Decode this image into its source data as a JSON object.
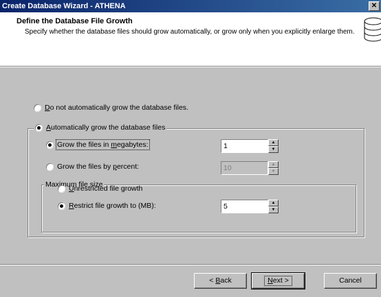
{
  "window": {
    "title": "Create Database Wizard - ATHENA",
    "close_glyph": "✕"
  },
  "header": {
    "title": "Define the Database File Growth",
    "description": "Specify whether the database files should grow automatically, or grow only when you explicitly enlarge them.",
    "icon": "database-cylinder-icon"
  },
  "options": {
    "no_grow": {
      "label_prefix": "",
      "mnemonic": "D",
      "label_rest": "o not automatically grow the database files.",
      "selected": false
    },
    "auto_grow": {
      "label_prefix": "",
      "mnemonic": "A",
      "label_rest": "utomatically grow the database files",
      "selected": true
    }
  },
  "growth": {
    "megabytes": {
      "label_prefix": "Grow the files in ",
      "mnemonic": "m",
      "label_rest": "egabytes:",
      "selected": true,
      "value": "1"
    },
    "percent": {
      "label_prefix": "Grow the files by ",
      "mnemonic": "p",
      "label_rest": "ercent:",
      "selected": false,
      "value": "10"
    }
  },
  "max_size": {
    "legend": "Maximum file size",
    "unrestricted": {
      "label_prefix": "",
      "mnemonic": "U",
      "label_rest": "nrestricted file growth",
      "selected": false
    },
    "restrict": {
      "label_prefix": "",
      "mnemonic": "R",
      "label_rest": "estrict file growth to (MB):",
      "selected": true,
      "value": "5"
    }
  },
  "buttons": {
    "back": {
      "prefix": "< ",
      "mnemonic": "B",
      "rest": "ack"
    },
    "next": {
      "prefix": "",
      "mnemonic": "N",
      "rest": "ext >"
    },
    "cancel": "Cancel"
  },
  "spin_glyphs": {
    "up": "▲",
    "down": "▼"
  }
}
